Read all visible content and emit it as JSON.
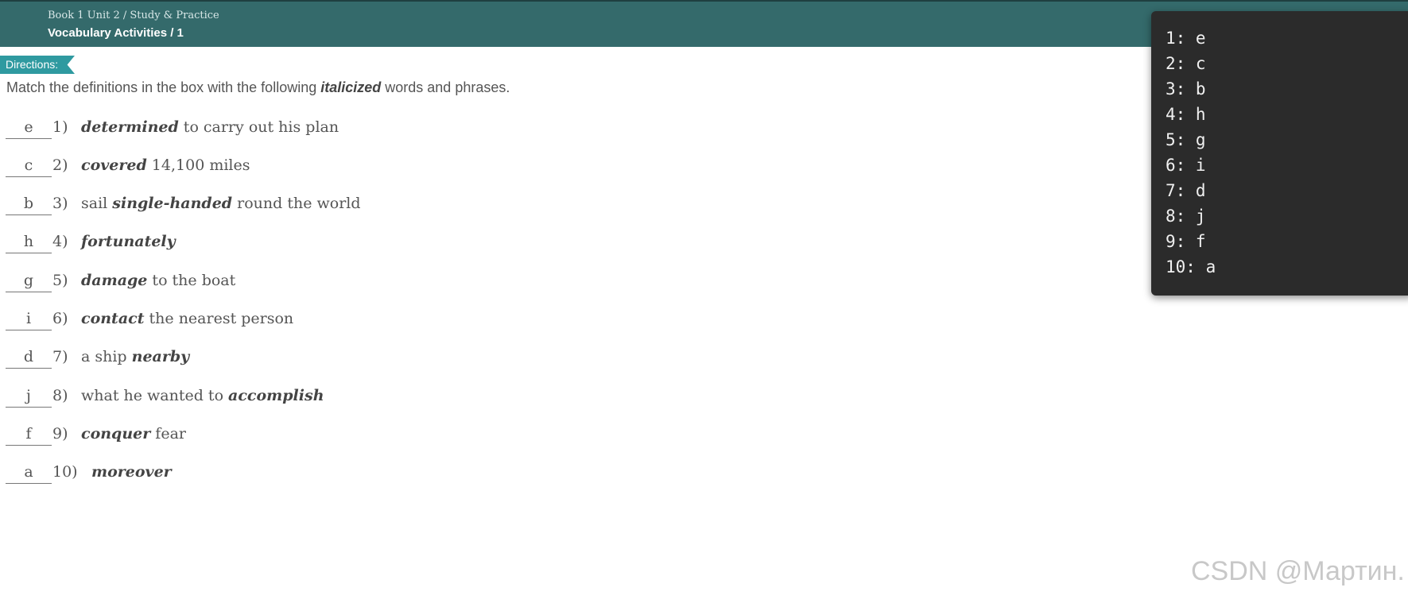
{
  "header": {
    "breadcrumb": "Book 1 Unit 2 / Study & Practice",
    "title": "Vocabulary Activities / 1"
  },
  "directions": {
    "tag": "Directions:",
    "text_before": "Match the definitions in the box with the following ",
    "text_italic": "italicized",
    "text_after": " words and phrases."
  },
  "items": [
    {
      "answer": "e",
      "num": "1)",
      "pre": "",
      "bold": "determined",
      "post": " to carry out his plan"
    },
    {
      "answer": "c",
      "num": "2)",
      "pre": "",
      "bold": "covered",
      "post": " 14,100 miles"
    },
    {
      "answer": "b",
      "num": "3)",
      "pre": "sail ",
      "bold": "single-handed",
      "post": " round the world"
    },
    {
      "answer": "h",
      "num": "4)",
      "pre": "",
      "bold": "fortunately",
      "post": ""
    },
    {
      "answer": "g",
      "num": "5)",
      "pre": "",
      "bold": "damage",
      "post": " to the boat"
    },
    {
      "answer": "i",
      "num": "6)",
      "pre": "",
      "bold": "contact",
      "post": " the nearest person"
    },
    {
      "answer": "d",
      "num": "7)",
      "pre": "a ship ",
      "bold": "nearby",
      "post": ""
    },
    {
      "answer": "j",
      "num": "8)",
      "pre": "what he wanted to ",
      "bold": "accomplish",
      "post": ""
    },
    {
      "answer": "f",
      "num": "9)",
      "pre": "",
      "bold": "conquer",
      "post": " fear"
    },
    {
      "answer": "a",
      "num": "10)",
      "pre": "",
      "bold": "moreover",
      "post": ""
    }
  ],
  "answer_panel": {
    "lines": [
      "1: e",
      "2: c",
      "3: b",
      "4: h",
      "5: g",
      "6: i",
      "7: d",
      "8: j",
      "9: f",
      "10: a"
    ]
  },
  "watermark": "CSDN @Мартин."
}
